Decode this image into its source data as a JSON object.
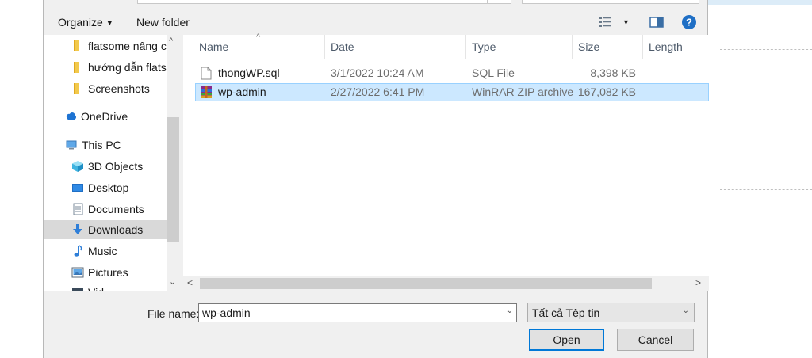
{
  "toolbar": {
    "organize": "Organize",
    "new_folder": "New folder"
  },
  "nav": {
    "items": [
      {
        "label": "flatsome nâng ca",
        "icon": "folder-icon"
      },
      {
        "label": "hướng dẫn flatso",
        "icon": "folder-icon"
      },
      {
        "label": "Screenshots",
        "icon": "folder-icon"
      },
      {
        "label": "OneDrive",
        "icon": "cloud-icon"
      },
      {
        "label": "This PC",
        "icon": "computer-icon"
      },
      {
        "label": "3D Objects",
        "icon": "cube-icon"
      },
      {
        "label": "Desktop",
        "icon": "desktop-icon"
      },
      {
        "label": "Documents",
        "icon": "document-icon"
      },
      {
        "label": "Downloads",
        "icon": "download-icon"
      },
      {
        "label": "Music",
        "icon": "music-icon"
      },
      {
        "label": "Pictures",
        "icon": "picture-icon"
      },
      {
        "label": "Vid",
        "icon": "video-icon"
      }
    ],
    "selected": "Downloads"
  },
  "columns": [
    "Name",
    "Date",
    "Type",
    "Size",
    "Length"
  ],
  "files": [
    {
      "name": "thongWP.sql",
      "date": "3/1/2022 10:24 AM",
      "type": "SQL File",
      "size": "8,398 KB",
      "icon": "file-icon"
    },
    {
      "name": "wp-admin",
      "date": "2/27/2022 6:41 PM",
      "type": "WinRAR ZIP archive",
      "size": "167,082 KB",
      "icon": "winrar-archive-icon"
    }
  ],
  "filename": {
    "label": "File name:",
    "value": "wp-admin"
  },
  "file_type": {
    "value": "Tất cả Tệp tin"
  },
  "buttons": {
    "open": "Open",
    "cancel": "Cancel"
  },
  "colors": {
    "selection": "#cce8ff",
    "accent": "#0078d7"
  }
}
